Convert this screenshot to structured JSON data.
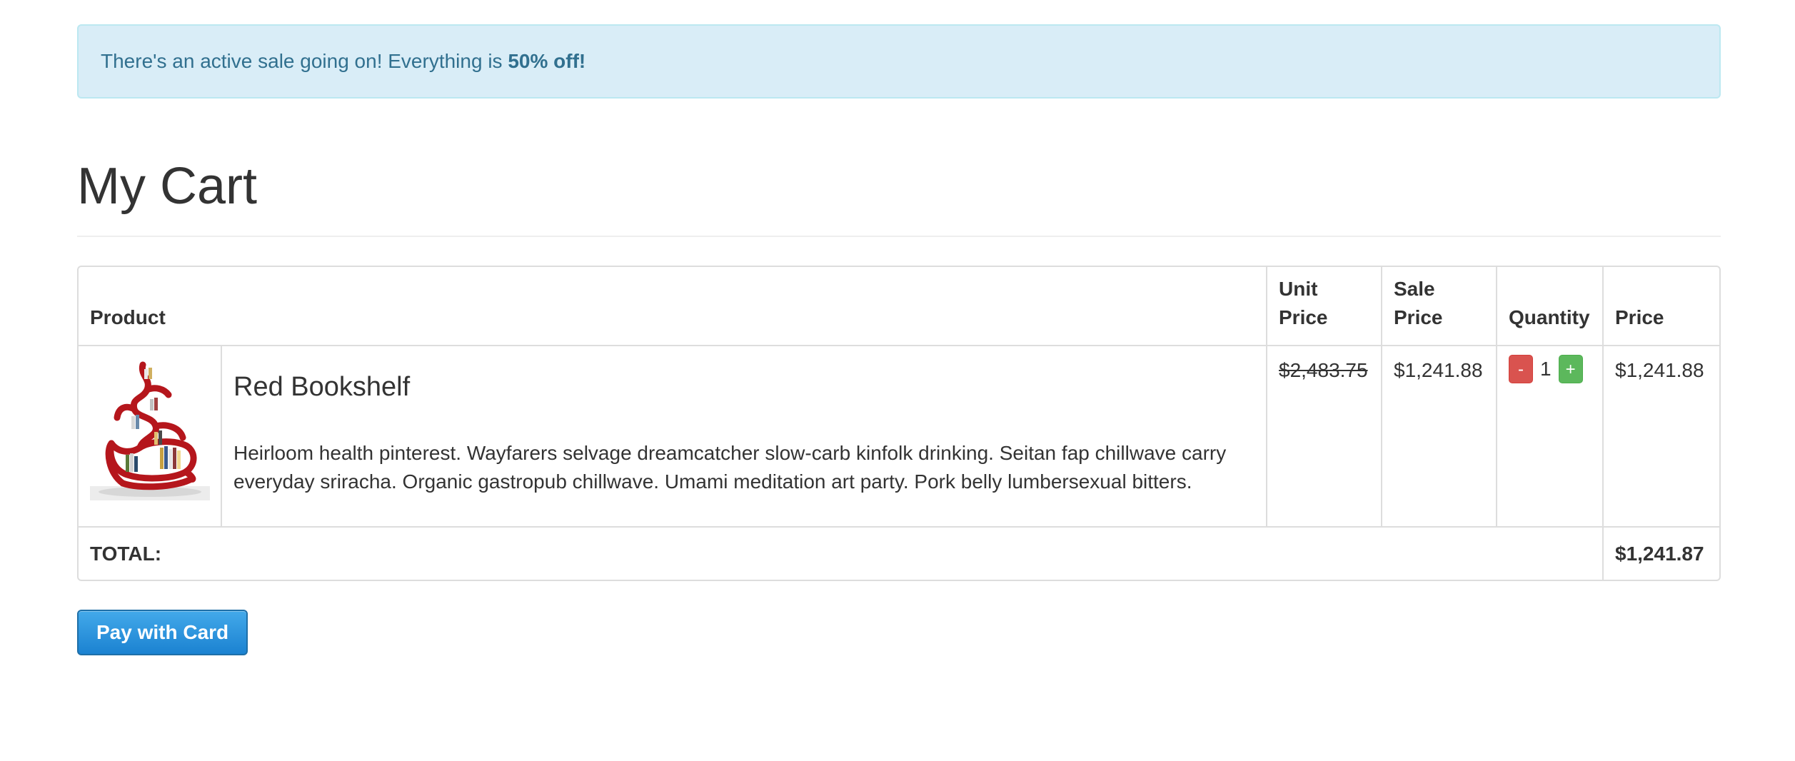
{
  "alert": {
    "text": "There's an active sale going on! Everything is ",
    "highlight": "50% off!"
  },
  "page": {
    "title": "My Cart"
  },
  "table": {
    "headers": {
      "product": "Product",
      "unit_price": "Unit Price",
      "sale_price": "Sale Price",
      "quantity": "Quantity",
      "price": "Price"
    },
    "items": [
      {
        "image_icon": "red-bookshelf-image",
        "name": "Red Bookshelf",
        "description": "Heirloom health pinterest. Wayfarers selvage dreamcatcher slow-carb kinfolk drinking. Seitan fap chillwave carry everyday sriracha. Organic gastropub chillwave. Umami meditation art party. Pork belly lumbersexual bitters.",
        "unit_price": "$2,483.75",
        "sale_price": "$1,241.88",
        "quantity": "1",
        "decrement_label": "-",
        "increment_label": "+",
        "price": "$1,241.88"
      }
    ],
    "total_label": "TOTAL:",
    "total_value": "$1,241.87"
  },
  "actions": {
    "pay_label": "Pay with Card"
  },
  "colors": {
    "alert_bg": "#d9edf7",
    "alert_text": "#31708f",
    "minus_button": "#d9534f",
    "plus_button": "#5cb85c",
    "pay_button": "#2a95e0"
  }
}
